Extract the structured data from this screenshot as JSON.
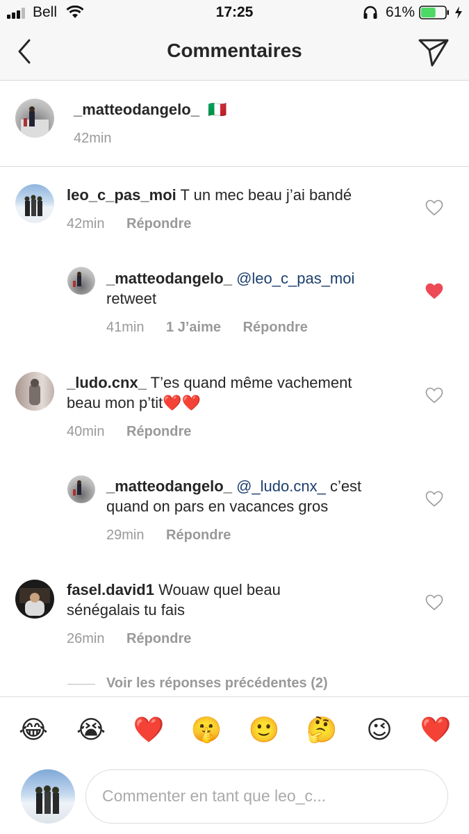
{
  "status_bar": {
    "carrier": "Bell",
    "time": "17:25",
    "battery": "61%",
    "battery_level": 0.61
  },
  "header": {
    "title": "Commentaires"
  },
  "caption": {
    "username": "_matteodangelo_",
    "flag": "🇮🇹",
    "time": "42min"
  },
  "comments": [
    {
      "username": "leo_c_pas_moi",
      "text": "T un mec beau j’ai bandé",
      "time": "42min",
      "reply_label": "Répondre",
      "liked": false
    },
    {
      "username": "_matteodangelo_",
      "mention": "@leo_c_pas_moi",
      "text": "retweet",
      "time": "41min",
      "likes_label": "1 J’aime",
      "reply_label": "Répondre",
      "liked": true
    },
    {
      "username": "_ludo.cnx_",
      "text_line1": "T’es quand même vachement",
      "text_line2": "beau mon p’tit",
      "text_emoji": "❤️❤️",
      "time": "40min",
      "reply_label": "Répondre",
      "liked": false
    },
    {
      "username": "_matteodangelo_",
      "mention": "@_ludo.cnx_",
      "text_line1": "c’est",
      "text_line2": "quand on pars en vacances gros",
      "time": "29min",
      "reply_label": "Répondre",
      "liked": false
    },
    {
      "username": "fasel.david1",
      "text_line1": "Wouaw quel beau",
      "text_line2": "sénégalais tu fais",
      "time": "26min",
      "reply_label": "Répondre",
      "liked": false
    }
  ],
  "view_previous": "Voir les réponses précédentes (2)",
  "emoji_bar": [
    "😂",
    "😭",
    "❤️",
    "🤫",
    "🙂",
    "🤔",
    "😉",
    "❤️"
  ],
  "composer": {
    "placeholder": "Commenter en tant que leo_c..."
  },
  "colors": {
    "liked_heart": "#ed4956",
    "mention": "#1c3f6e",
    "meta_gray": "#999999"
  }
}
